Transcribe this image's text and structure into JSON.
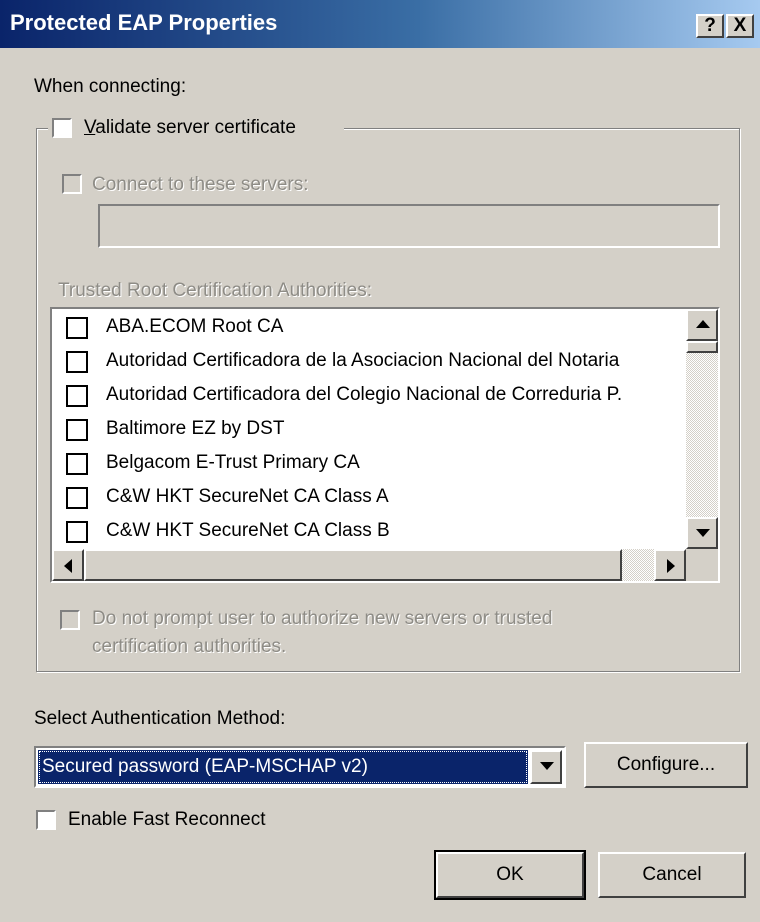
{
  "window": {
    "title": "Protected EAP Properties",
    "help_label": "?",
    "close_label": "X"
  },
  "when_connecting_label": "When connecting:",
  "validate_cert": {
    "label_first": "V",
    "label_rest": "alidate server certificate",
    "checked": false
  },
  "connect_servers": {
    "label_first": "Connect to these servers:",
    "checked": false,
    "enabled": false,
    "value": ""
  },
  "trusted_root": {
    "label": "Trusted Root Certification Authorities:"
  },
  "ca_list": [
    {
      "name": "ABA.ECOM Root CA",
      "checked": false
    },
    {
      "name": "Autoridad Certificadora de la Asociacion Nacional del Notaria",
      "checked": false
    },
    {
      "name": "Autoridad Certificadora del Colegio Nacional de Correduria P.",
      "checked": false
    },
    {
      "name": "Baltimore EZ by DST",
      "checked": false
    },
    {
      "name": "Belgacom E-Trust Primary CA",
      "checked": false
    },
    {
      "name": "C&W HKT SecureNet CA Class A",
      "checked": false
    },
    {
      "name": "C&W HKT SecureNet CA Class B",
      "checked": false
    }
  ],
  "do_not_prompt": {
    "line1": "Do not prompt user to authorize new servers or trusted",
    "line2": "certification authorities.",
    "checked": false,
    "enabled": false
  },
  "auth_method": {
    "label": "Select Authentication Method:",
    "selected": "Secured password (EAP-MSCHAP v2)",
    "configure_label": "Configure..."
  },
  "fast_reconnect": {
    "label": "Enable Fast Reconnect",
    "checked": false
  },
  "buttons": {
    "ok": "OK",
    "cancel": "Cancel"
  },
  "colors": {
    "title_start": "#0a246a",
    "title_end": "#a6caf0",
    "face": "#d4d0c8",
    "selection": "#0a246a"
  }
}
